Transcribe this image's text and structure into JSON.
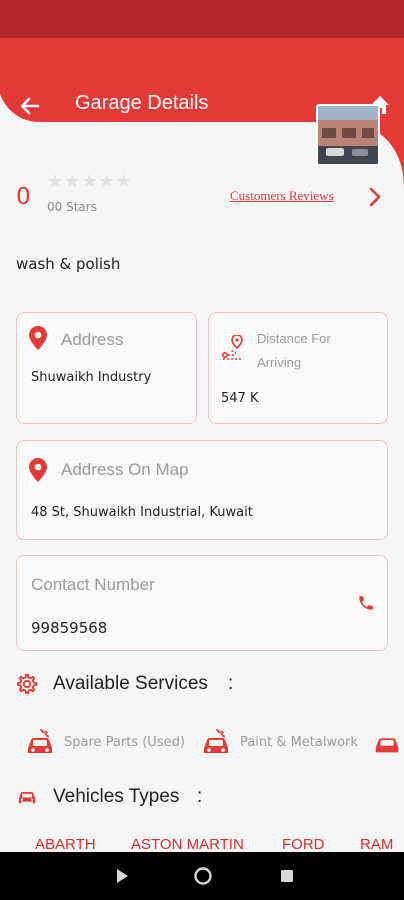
{
  "header": {
    "title": "Garage Details",
    "back_icon": "arrow-left-icon",
    "home_icon": "home-icon"
  },
  "rating": {
    "value": "0",
    "stars_filled": 0,
    "stars_total": 5,
    "stars_label": "00 Stars",
    "reviews_link": "Customers Reviews"
  },
  "description": "wash & polish",
  "address": {
    "label": "Address",
    "value": "Shuwaikh Industry"
  },
  "distance": {
    "label": "Distance For Arriving",
    "value": "547 K"
  },
  "map_address": {
    "label": "Address On Map",
    "value": "48 St, Shuwaikh Industrial, Kuwait"
  },
  "contact": {
    "label": "Contact Number",
    "value": "99859568"
  },
  "services": {
    "title": "Available Services",
    "colon": ":",
    "items": [
      "Spare Parts (Used)",
      "Paint & Metalwork"
    ]
  },
  "vehicles": {
    "title": "Vehicles Types",
    "colon": ":",
    "items": [
      "ABARTH",
      "ASTON MARTIN",
      "FORD",
      "RAM"
    ]
  },
  "colors": {
    "primary": "#e53935",
    "status_bar": "#b4262a",
    "border": "#efc3c3"
  }
}
